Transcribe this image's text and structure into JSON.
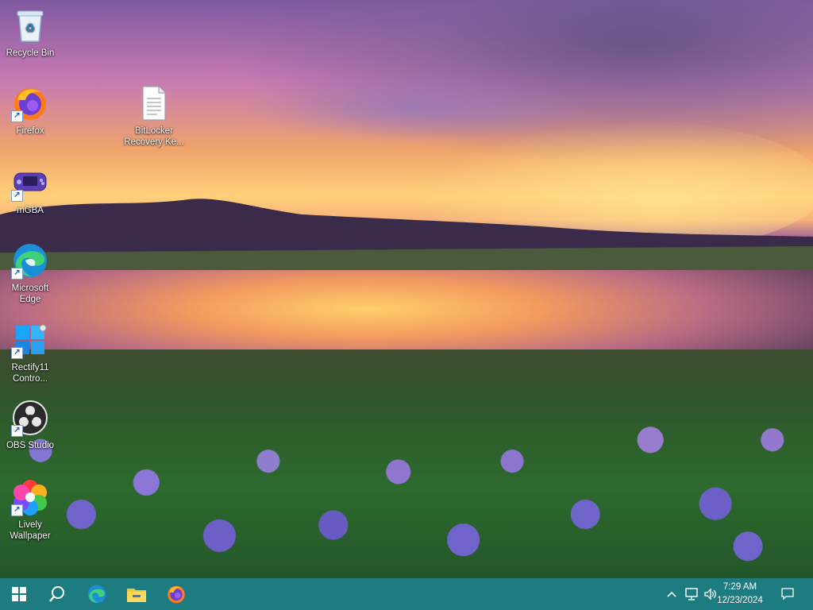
{
  "desktop": {
    "icons": [
      {
        "label": "Recycle Bin",
        "icon": "recycle-bin-icon"
      },
      {
        "label": "Firefox",
        "icon": "firefox-icon"
      },
      {
        "label": "BitLocker Recovery Ke...",
        "icon": "document-icon"
      },
      {
        "label": "mGBA",
        "icon": "mgba-icon"
      },
      {
        "label": "Microsoft Edge",
        "icon": "edge-icon"
      },
      {
        "label": "Rectify11 Contro...",
        "icon": "rectify11-icon"
      },
      {
        "label": "OBS Studio",
        "icon": "obs-studio-icon"
      },
      {
        "label": "Lively Wallpaper",
        "icon": "lively-wallpaper-icon"
      }
    ]
  },
  "taskbar": {
    "color": "#1d7c80",
    "pinned": [
      "windows-start-icon",
      "search-icon",
      "edge-icon",
      "file-explorer-icon",
      "firefox-icon"
    ],
    "tray_icons": [
      "chevron-up-icon",
      "network-icon",
      "volume-icon",
      "notification-icon"
    ],
    "clock": {
      "time": "7:29 AM",
      "date": "12/23/2024"
    }
  }
}
